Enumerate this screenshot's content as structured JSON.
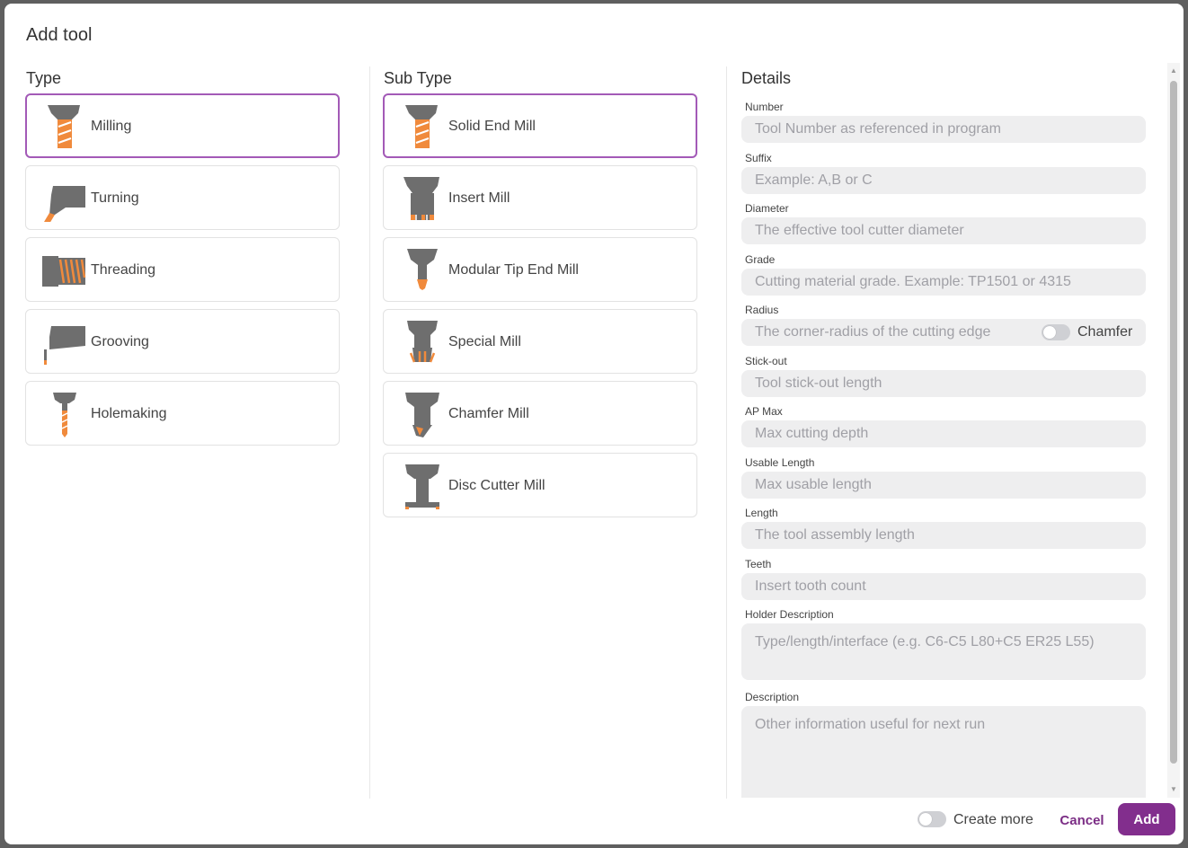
{
  "dialog": {
    "title": "Add tool"
  },
  "type_column": {
    "title": "Type",
    "items": [
      {
        "label": "Milling",
        "icon": "milling-icon",
        "selected": true
      },
      {
        "label": "Turning",
        "icon": "turning-icon"
      },
      {
        "label": "Threading",
        "icon": "threading-icon"
      },
      {
        "label": "Grooving",
        "icon": "grooving-icon"
      },
      {
        "label": "Holemaking",
        "icon": "holemaking-icon"
      }
    ]
  },
  "subtype_column": {
    "title": "Sub Type",
    "items": [
      {
        "label": "Solid End Mill",
        "icon": "solid-end-mill-icon",
        "selected": true
      },
      {
        "label": "Insert Mill",
        "icon": "insert-mill-icon"
      },
      {
        "label": "Modular Tip End Mill",
        "icon": "modular-tip-end-mill-icon"
      },
      {
        "label": "Special Mill",
        "icon": "special-mill-icon"
      },
      {
        "label": "Chamfer Mill",
        "icon": "chamfer-mill-icon"
      },
      {
        "label": "Disc Cutter Mill",
        "icon": "disc-cutter-mill-icon"
      }
    ]
  },
  "details": {
    "title": "Details",
    "fields": [
      {
        "label": "Number",
        "placeholder": "Tool Number as referenced in program",
        "value": ""
      },
      {
        "label": "Suffix",
        "placeholder": "Example: A,B or C",
        "value": ""
      },
      {
        "label": "Diameter",
        "placeholder": "The effective tool cutter diameter",
        "value": ""
      },
      {
        "label": "Grade",
        "placeholder": "Cutting material grade. Example: TP1501 or 4315",
        "value": ""
      },
      {
        "label": "Radius",
        "placeholder": "The corner-radius of the cutting edge",
        "value": ""
      },
      {
        "label": "Stick-out",
        "placeholder": "Tool stick-out length",
        "value": ""
      },
      {
        "label": "AP Max",
        "placeholder": "Max cutting depth",
        "value": ""
      },
      {
        "label": "Usable Length",
        "placeholder": "Max usable length",
        "value": ""
      },
      {
        "label": "Length",
        "placeholder": "The tool assembly length",
        "value": ""
      },
      {
        "label": "Teeth",
        "placeholder": "Insert tooth count",
        "value": ""
      },
      {
        "label": "Holder Description",
        "placeholder": "Type/length/interface (e.g. C6-C5 L80+C5 ER25 L55)",
        "value": ""
      },
      {
        "label": "Description",
        "placeholder": "Other information useful for next run",
        "value": ""
      }
    ],
    "chamfer_toggle": {
      "label": "Chamfer",
      "on": false
    }
  },
  "footer": {
    "create_more": {
      "label": "Create more",
      "on": false
    },
    "cancel_label": "Cancel",
    "add_label": "Add"
  },
  "colors": {
    "accent": "#822e8d",
    "selected_border": "#a35ab7",
    "tool_body": "#6e6e6e",
    "tool_tip": "#f08a3c",
    "input_bg": "#eeeeef"
  }
}
